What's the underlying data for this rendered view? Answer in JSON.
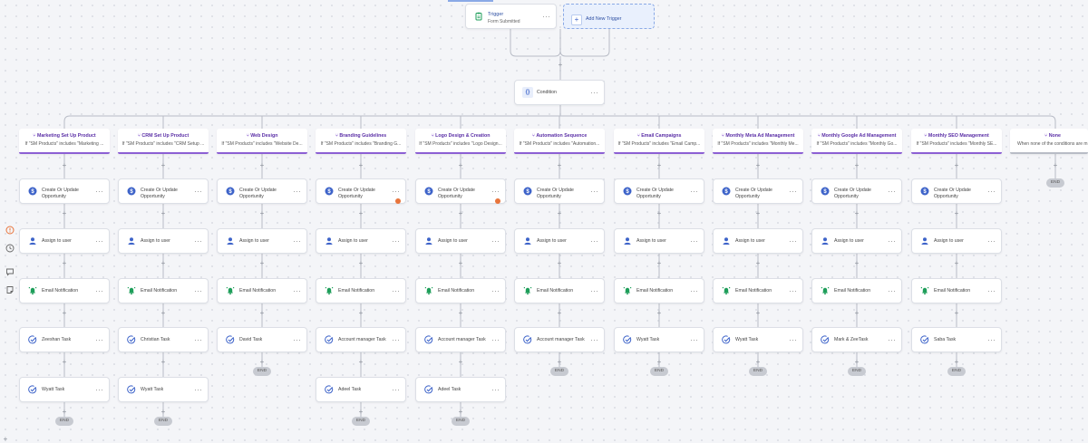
{
  "trigger": {
    "title": "Trigger",
    "subtitle": "Form Submitted",
    "add_label": "Add New Trigger"
  },
  "condition": {
    "label": "Condition"
  },
  "branches": [
    {
      "title": "Marketing Set Up Product",
      "subtitle": "If \"SM Products\" includes \"Marketing ...",
      "task": "Zeeshan Task",
      "second_task": "Wyatt Task"
    },
    {
      "title": "CRM Set Up Product",
      "subtitle": "If \"SM Products\" includes \"CRM Setup ...",
      "task": "Christian Task",
      "second_task": "Wyatt Task"
    },
    {
      "title": "Web Design",
      "subtitle": "If \"SM Products\" includes \"Website De...",
      "task": "David Task",
      "second_task": null
    },
    {
      "title": "Branding Guidelines",
      "subtitle": "If \"SM Products\" includes \"Branding G...",
      "task": "Account manager Task",
      "second_task": "Adeel Task"
    },
    {
      "title": "Logo Design & Creation",
      "subtitle": "If \"SM Products\" includes \"Logo Design...",
      "task": "Account manager Task",
      "second_task": "Adeel Task"
    },
    {
      "title": "Automation Sequence",
      "subtitle": "If \"SM Products\" includes \"Automation...",
      "task": "Account manager Task",
      "second_task": null
    },
    {
      "title": "Email Campaigns",
      "subtitle": "If \"SM Products\" includes \"Email Camp...",
      "task": "Wyatt Task",
      "second_task": null
    },
    {
      "title": "Monthly Meta Ad Management",
      "subtitle": "If \"SM Products\" includes \"Monthly Me...",
      "task": "Wyatt Task",
      "second_task": null
    },
    {
      "title": "Monthly Google Ad Management",
      "subtitle": "If \"SM Products\" includes \"Monthly Go...",
      "task": "Mark & ZeeTask",
      "second_task": null
    },
    {
      "title": "Monthly SEO Management",
      "subtitle": "If \"SM Products\" includes \"Monthly SE...",
      "task": "Saba Task",
      "second_task": null
    }
  ],
  "none_branch": {
    "title": "None",
    "subtitle": "When none of the conditions are m"
  },
  "actions": {
    "opportunity": "Create Or Update Opportunity",
    "assign": "Assign to user",
    "email": "Email Notification"
  },
  "end_label": "END",
  "icons": {
    "trigger": "clipboard-icon",
    "condition": "braces-icon",
    "branch": "branch-icon",
    "opportunity": "dollar-icon",
    "assign": "user-icon",
    "email": "bell-icon",
    "task": "check-circle-icon"
  },
  "colors": {
    "accent_purple": "#7a48c8",
    "accent_blue": "#3d63c9",
    "green": "#1e9e5a",
    "warning": "#e8743b"
  }
}
